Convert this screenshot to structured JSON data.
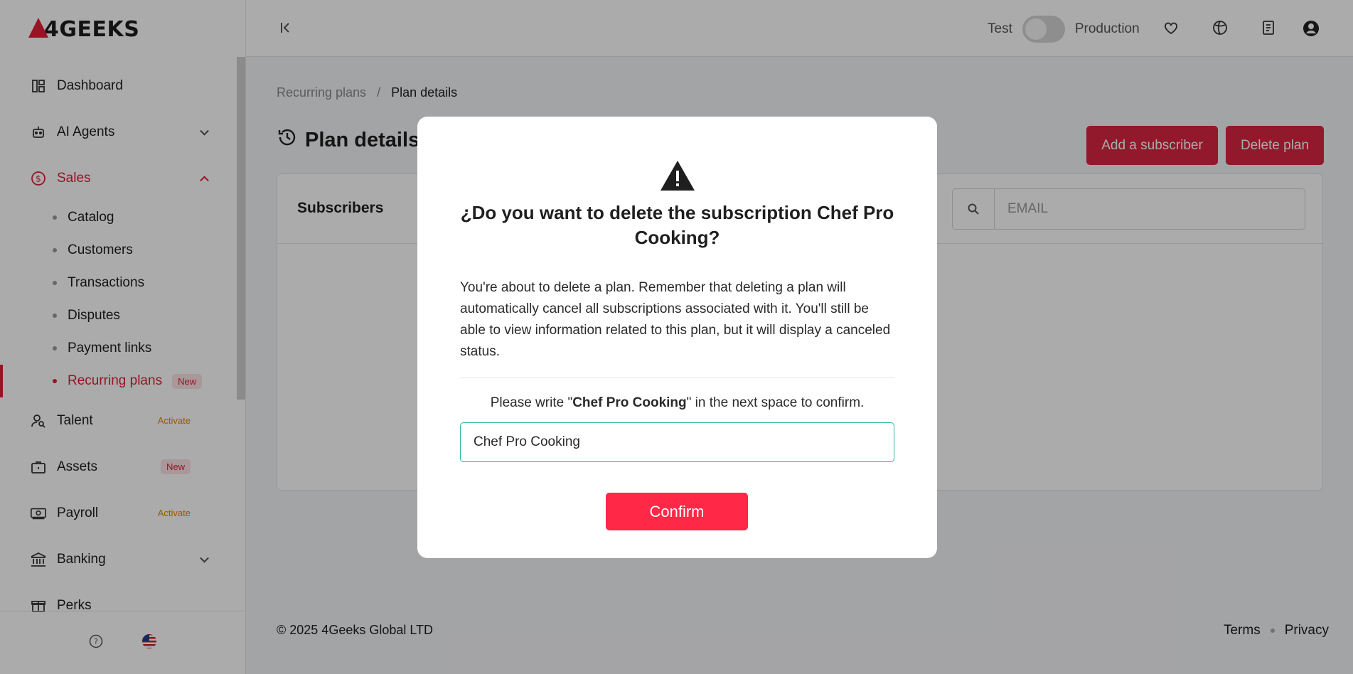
{
  "brand": {
    "logo_text": "GEEKS",
    "accent": "#e01e37"
  },
  "sidebar": {
    "items": [
      {
        "label": "Dashboard",
        "icon": "dashboard-icon"
      },
      {
        "label": "AI Agents",
        "icon": "robot-icon"
      },
      {
        "label": "Sales",
        "icon": "dollar-icon"
      },
      {
        "label": "Talent",
        "icon": "user-search-icon",
        "badge": "Activate"
      },
      {
        "label": "Assets",
        "icon": "briefcase-icon",
        "badge": "New"
      },
      {
        "label": "Payroll",
        "icon": "cash-icon",
        "badge": "Activate"
      },
      {
        "label": "Banking",
        "icon": "bank-icon"
      },
      {
        "label": "Perks",
        "icon": "gift-icon"
      }
    ],
    "sales_sub": [
      {
        "label": "Catalog"
      },
      {
        "label": "Customers"
      },
      {
        "label": "Transactions"
      },
      {
        "label": "Disputes"
      },
      {
        "label": "Payment links"
      },
      {
        "label": "Recurring plans",
        "badge": "New"
      }
    ]
  },
  "header": {
    "test_label": "Test",
    "prod_label": "Production"
  },
  "breadcrumb": {
    "parent": "Recurring plans",
    "separator": "/",
    "current": "Plan details"
  },
  "page": {
    "title": "Plan details",
    "add_subscriber": "Add a subscriber",
    "delete_plan": "Delete plan",
    "card_title": "Subscribers",
    "search_placeholder": "EMAIL"
  },
  "footer": {
    "copyright": "© 2025 4Geeks Global LTD",
    "terms": "Terms",
    "privacy": "Privacy"
  },
  "modal": {
    "title": "¿Do you want to delete the subscription Chef Pro Cooking?",
    "body": "You're about to delete a plan. Remember that deleting a plan will automatically cancel all subscriptions associated with it. You'll still be able to view information related to this plan, but it will display a canceled status.",
    "prompt_before": "Please write \"",
    "prompt_name": "Chef Pro Cooking",
    "prompt_after": "\" in the next space to confirm.",
    "input_value": "Chef Pro Cooking",
    "confirm_label": "Confirm"
  }
}
